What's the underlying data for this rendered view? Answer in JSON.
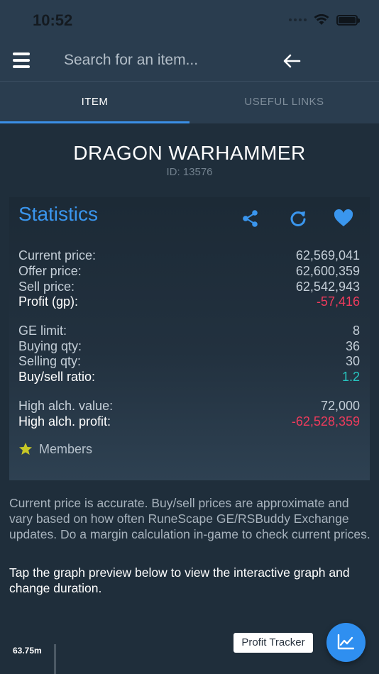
{
  "status_bar": {
    "time": "10:52"
  },
  "search": {
    "placeholder": "Search for an item..."
  },
  "tabs": [
    {
      "label": "ITEM",
      "active": true
    },
    {
      "label": "USEFUL LINKS",
      "active": false
    }
  ],
  "item": {
    "name": "DRAGON WARHAMMER",
    "id_text": "ID: 13576"
  },
  "stats": {
    "title": "Statistics",
    "rows": [
      {
        "label": "Current price:",
        "value": "62,569,041"
      },
      {
        "label": "Offer price:",
        "value": "62,600,359"
      },
      {
        "label": "Sell price:",
        "value": "62,542,943"
      },
      {
        "label": "Profit (gp):",
        "value": "-57,416"
      },
      {
        "label": "GE limit:",
        "value": "8"
      },
      {
        "label": "Buying qty:",
        "value": "36"
      },
      {
        "label": "Selling qty:",
        "value": "30"
      },
      {
        "label": "Buy/sell ratio:",
        "value": "1.2"
      },
      {
        "label": "High alch. value:",
        "value": "72,000"
      },
      {
        "label": "High alch. profit:",
        "value": "-62,528,359"
      }
    ],
    "members_label": "Members"
  },
  "info": {
    "accuracy_note": "Current price is accurate. Buy/sell prices are approximate and vary based on how often RuneScape GE/RSBuddy Exchange updates. Do a margin calculation in-game to check current prices.",
    "graph_hint": "Tap the graph preview below to view the interactive graph and change duration."
  },
  "graph_preview": {
    "y_label": "63.75m"
  },
  "profit_tracker": {
    "label": "Profit Tracker"
  },
  "colors": {
    "accent": "#3b8fe6",
    "negative": "#ef3b5c",
    "positive": "#27c6c0",
    "star": "#c8c826",
    "header_bg": "#2a3d4f",
    "page_bg": "#1f2e3b"
  },
  "icons": [
    "menu-icon",
    "back-arrow-icon",
    "share-icon",
    "refresh-icon",
    "heart-icon",
    "star-icon",
    "chart-icon",
    "wifi-icon",
    "battery-icon"
  ]
}
